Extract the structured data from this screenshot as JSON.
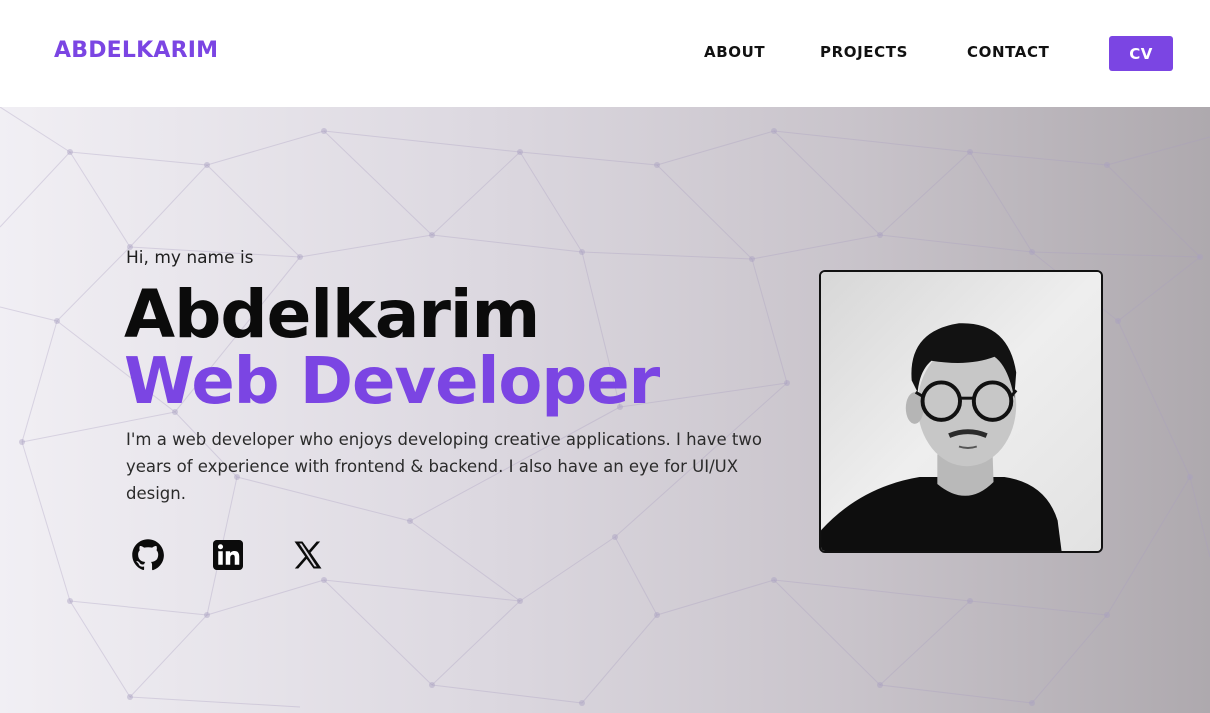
{
  "header": {
    "brand": "ABDELKARIM",
    "nav": [
      "ABOUT",
      "PROJECTS",
      "CONTACT"
    ],
    "cv_label": "CV"
  },
  "hero": {
    "greeting": "Hi, my name is",
    "name": "Abdelkarim",
    "role": "Web Developer",
    "bio": "I'm a web developer who enjoys developing creative applications. I have two years of experience with frontend & backend. I also have an eye for UI/UX design.",
    "socials": [
      "github-icon",
      "linkedin-icon",
      "x-icon"
    ]
  },
  "colors": {
    "accent": "#7b45e3",
    "text_dark": "#0b0b0b"
  }
}
